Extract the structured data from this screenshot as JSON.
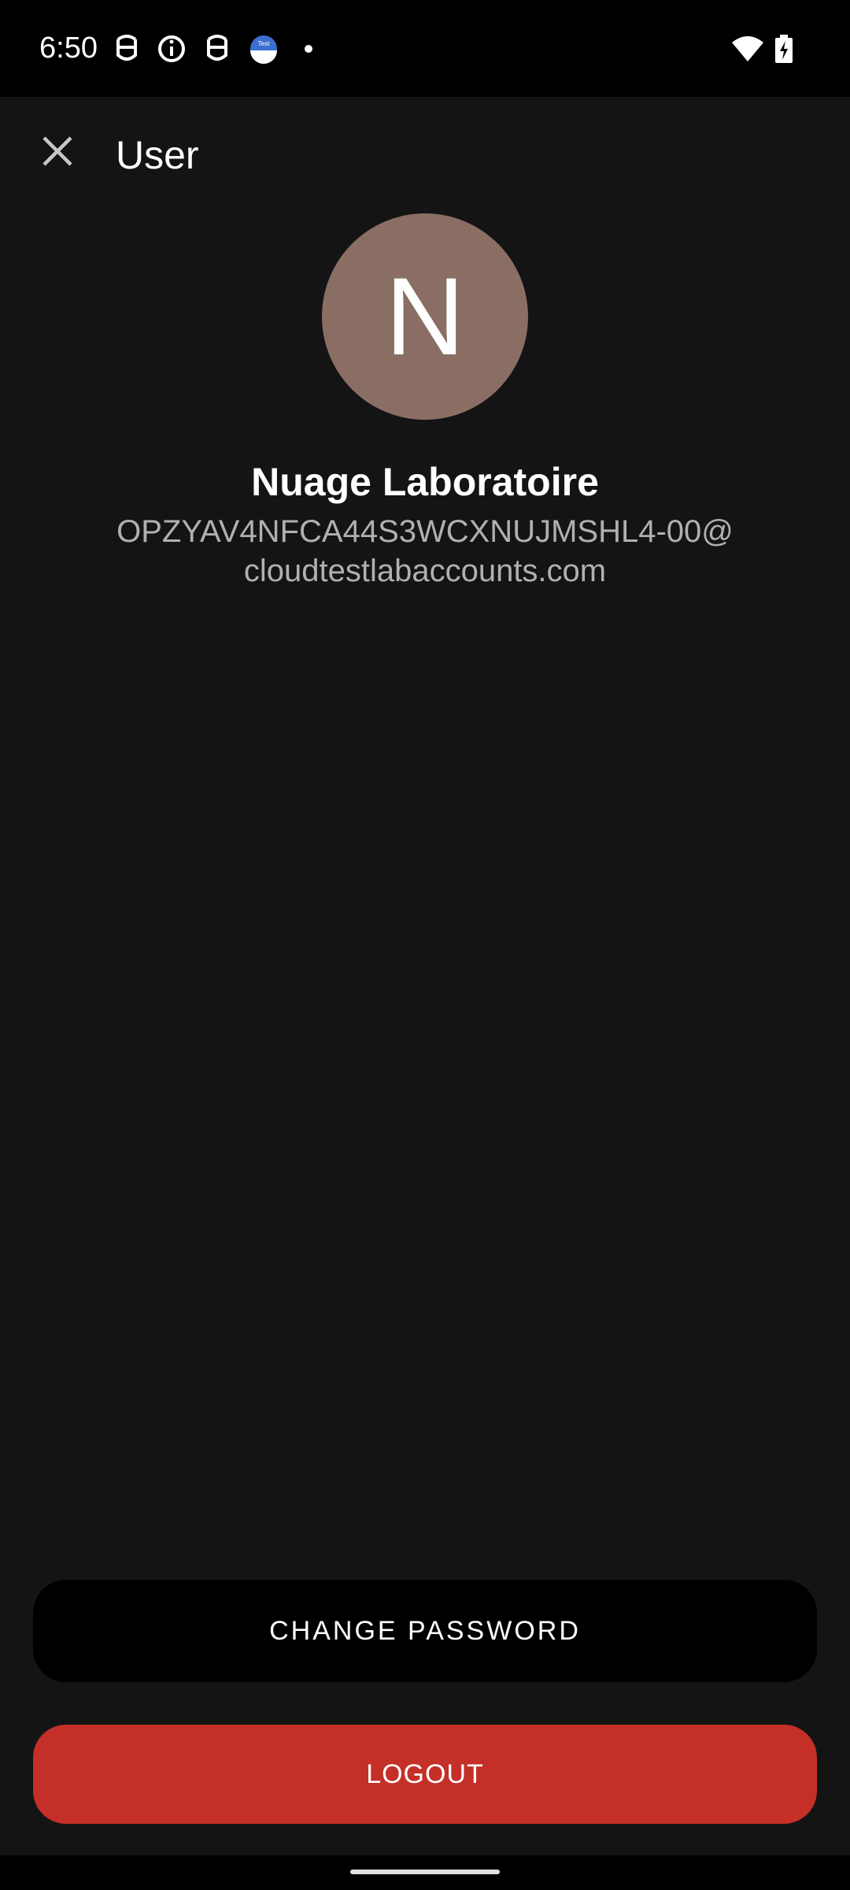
{
  "status_bar": {
    "time": "6:50",
    "icons": [
      "notification-icon",
      "info-icon",
      "notification-icon",
      "test-lab-icon",
      "dot-icon",
      "wifi-icon",
      "battery-charging-icon"
    ],
    "test_badge_text": "Test"
  },
  "app_bar": {
    "close_icon": "close-icon",
    "title": "User"
  },
  "profile": {
    "avatar_initial": "N",
    "avatar_color": "#8a6e64",
    "name": "Nuage Laboratoire",
    "email": "OPZYAV4NFCA44S3WCXNUJMSHL4-00@cloudtestlabaccounts.com"
  },
  "actions": {
    "change_password_label": "CHANGE PASSWORD",
    "logout_label": "LOGOUT",
    "logout_color": "#c42f27"
  }
}
